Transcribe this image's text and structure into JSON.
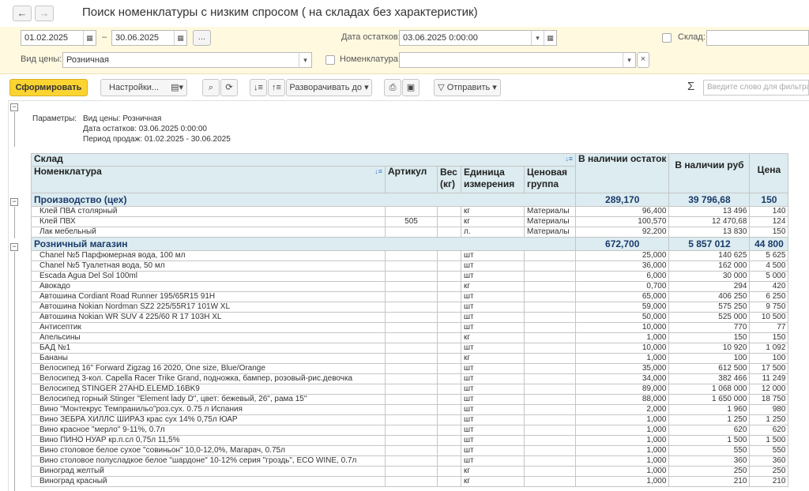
{
  "window": {
    "title": "Поиск номенклатуры с низким спросом ( на складах без характеристик)",
    "back_icon": "←",
    "forward_icon": "→"
  },
  "settings": {
    "date_from": "01.02.2025",
    "date_to": "30.06.2025",
    "dash": "–",
    "dots": "...",
    "stock_date_label": "Дата остатков:",
    "stock_date": "03.06.2025  0:00:00",
    "warehouse_label": "Склад:",
    "price_type_label": "Вид цены:",
    "price_type": "Розничная",
    "nomenclature_label": "Номенклатура:",
    "clear_icon": "×"
  },
  "toolbar": {
    "generate": "Сформировать",
    "settings": "Настройки...",
    "expand": "Разворачивать до",
    "send": "Отправить",
    "sigma": "Σ",
    "search_placeholder": "Введите слово для фильтра"
  },
  "parameters": {
    "label": "Параметры:",
    "lines": [
      "Вид цены: Розничная",
      "Дата остатков: 03.06.2025 0:00:00",
      "Период продаж: 01.02.2025 - 30.06.2025"
    ]
  },
  "table": {
    "headers": {
      "warehouse": "Склад",
      "nomenclature": "Номенклатура",
      "article": "Артикул",
      "weight": "Вес (кг)",
      "unit": "Единица измерения",
      "price_group": "Ценовая группа",
      "qty": "В наличии остаток",
      "rub": "В наличии руб",
      "price": "Цена"
    },
    "groups": [
      {
        "name": "Производство (цех)",
        "qty": "289,170",
        "rub": "39 796,68",
        "price": "150",
        "rows": [
          [
            "Клей ПВА столярный",
            "",
            "",
            "кг",
            "Материалы",
            "96,400",
            "13 496",
            "140"
          ],
          [
            "Клей ПВХ",
            "505",
            "",
            "кг",
            "Материалы",
            "100,570",
            "12 470,68",
            "124"
          ],
          [
            "Лак мебельный",
            "",
            "",
            "л.",
            "Материалы",
            "92,200",
            "13 830",
            "150"
          ]
        ]
      },
      {
        "name": "Розничный магазин",
        "qty": "672,700",
        "rub": "5 857 012",
        "price": "44 800",
        "rows": [
          [
            "Chanel №5 Парфюмерная вода, 100 мл",
            "",
            "",
            "шт",
            "",
            "25,000",
            "140 625",
            "5 625"
          ],
          [
            "Chanel №5 Туалетная вода, 50 мл",
            "",
            "",
            "шт",
            "",
            "36,000",
            "162 000",
            "4 500"
          ],
          [
            "Escada Agua Del Sol 100ml",
            "",
            "",
            "шт",
            "",
            "6,000",
            "30 000",
            "5 000"
          ],
          [
            "Авокадо",
            "",
            "",
            "кг",
            "",
            "0,700",
            "294",
            "420"
          ],
          [
            "Автошина Cordiant Road Runner 195/65R15 91H",
            "",
            "",
            "шт",
            "",
            "65,000",
            "406 250",
            "6 250"
          ],
          [
            "Автошина Nokian Nordman SZ2 225/55R17 101W XL",
            "",
            "",
            "шт",
            "",
            "59,000",
            "575 250",
            "9 750"
          ],
          [
            "Автошина Nokian WR SUV 4 225/60 R 17 103H XL",
            "",
            "",
            "шт",
            "",
            "50,000",
            "525 000",
            "10 500"
          ],
          [
            "Антисептик",
            "",
            "",
            "шт",
            "",
            "10,000",
            "770",
            "77"
          ],
          [
            "Апельсины",
            "",
            "",
            "кг",
            "",
            "1,000",
            "150",
            "150"
          ],
          [
            "БАД №1",
            "",
            "",
            "шт",
            "",
            "10,000",
            "10 920",
            "1 092"
          ],
          [
            "Бананы",
            "",
            "",
            "кг",
            "",
            "1,000",
            "100",
            "100"
          ],
          [
            "Велосипед 16\" Forward Zigzag 16 2020, One size, Blue/Orange",
            "",
            "",
            "шт",
            "",
            "35,000",
            "612 500",
            "17 500"
          ],
          [
            "Велосипед 3-кол. Capella Racer Trike Grand, подножка, бампер, розовый-рис.девочка",
            "",
            "",
            "шт",
            "",
            "34,000",
            "382 466",
            "11 249"
          ],
          [
            "Велосипед STINGER 27AHD.ELEMD.16BK9",
            "",
            "",
            "шт",
            "",
            "89,000",
            "1 068 000",
            "12 000"
          ],
          [
            "Велосипед горный Stinger \"Element lady D\", цвет: бежевый, 26\", рама 15\"",
            "",
            "",
            "шт",
            "",
            "88,000",
            "1 650 000",
            "18 750"
          ],
          [
            "Вино \"Монтекрус Темпранильо\"роз.сух. 0.75 л Испания",
            "",
            "",
            "шт",
            "",
            "2,000",
            "1 960",
            "980"
          ],
          [
            "Вино ЗЕБРА ХИЛЛС ШИРАЗ крас сух 14% 0,75л ЮАР",
            "",
            "",
            "шт",
            "",
            "1,000",
            "1 250",
            "1 250"
          ],
          [
            "Вино красное \"мерло\" 9-11%, 0.7л",
            "",
            "",
            "шт",
            "",
            "1,000",
            "620",
            "620"
          ],
          [
            "Вино ПИНО НУАР кр.п.сл 0,75л 11,5%",
            "",
            "",
            "шт",
            "",
            "1,000",
            "1 500",
            "1 500"
          ],
          [
            "Вино столовое белое сухое \"совиньон\" 10,0-12,0%, Магарач, 0.75л",
            "",
            "",
            "шт",
            "",
            "1,000",
            "550",
            "550"
          ],
          [
            "Вино столовое полусладкое белое \"шардоне\" 10-12% серия \"гроздь\", ECO WINE, 0.7л",
            "",
            "",
            "шт",
            "",
            "1,000",
            "360",
            "360"
          ],
          [
            "Виноград желтый",
            "",
            "",
            "кг",
            "",
            "1,000",
            "250",
            "250"
          ],
          [
            "Виноград красный",
            "",
            "",
            "кг",
            "",
            "1,000",
            "210",
            "210"
          ]
        ]
      }
    ]
  }
}
